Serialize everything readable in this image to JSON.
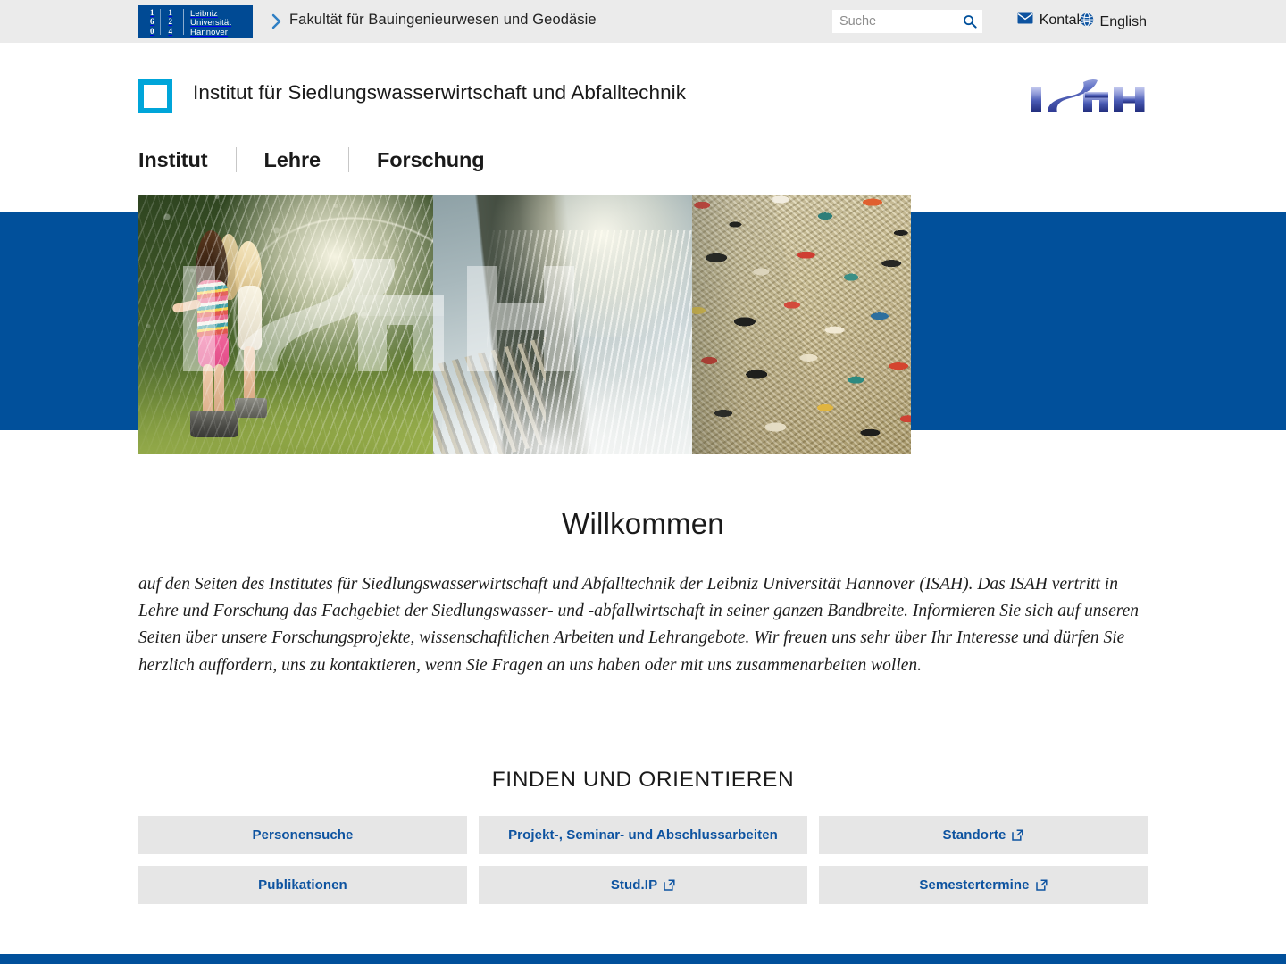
{
  "topbar": {
    "university_logo": {
      "grid_chars": [
        "1",
        "1",
        "6",
        "2",
        "0",
        "4"
      ],
      "lines": [
        "Leibniz",
        "Universität",
        "Hannover"
      ]
    },
    "faculty_chevron_icon": "chevron-right-icon",
    "faculty_title": "Fakultät für Bauingenieurwesen und Geodäsie",
    "search": {
      "placeholder": "Suche",
      "value": "",
      "icon": "search-icon"
    },
    "contact": {
      "label": "Kontakt",
      "icon": "envelope-icon"
    },
    "language": {
      "label": "English",
      "icon": "globe-icon"
    }
  },
  "institute_header": {
    "square_icon": "square-outline-icon",
    "title": "Institut für Siedlungswasserwirtschaft und Abfalltechnik",
    "logo_text": "ISAH",
    "logo_name": "isah-logo"
  },
  "mainnav": {
    "items": [
      {
        "label": "Institut"
      },
      {
        "label": "Lehre"
      },
      {
        "label": "Forschung"
      }
    ]
  },
  "hero": {
    "watermark_text": "ISAH",
    "panes": [
      {
        "name": "children-sprinkler-photo"
      },
      {
        "name": "water-weir-channel-photo"
      },
      {
        "name": "shredded-waste-photo"
      }
    ],
    "band_color": "#01509b"
  },
  "welcome": {
    "title": "Willkommen",
    "body": "auf den Seiten des Institutes für Siedlungswasserwirtschaft und Abfalltechnik der Leibniz Universität Hannover (ISAH). Das ISAH vertritt in Lehre und Forschung das Fachgebiet der Siedlungswasser- und -abfallwirtschaft in seiner ganzen Bandbreite. Informieren Sie sich auf unseren Seiten über unsere Forschungsprojekte, wissenschaftlichen Arbeiten und Lehrangebote. Wir freuen uns sehr über Ihr Interesse und dürfen Sie herzlich auffordern, uns zu kontaktieren, wenn Sie Fragen an uns haben oder mit uns zusammenarbeiten wollen."
  },
  "finder": {
    "heading": "FINDEN UND ORIENTIEREN",
    "tiles": [
      {
        "label": "Personensuche",
        "external": false
      },
      {
        "label": "Projekt-, Seminar- und Abschlussarbeiten",
        "external": false
      },
      {
        "label": "Standorte",
        "external": true
      },
      {
        "label": "Publikationen",
        "external": false
      },
      {
        "label": "Stud.IP",
        "external": true
      },
      {
        "label": "Semestertermine",
        "external": true
      }
    ]
  },
  "colors": {
    "brand_blue": "#01509b",
    "leibniz_blue": "#004a94",
    "accent_cyan": "#00a5d9",
    "link_blue": "#0d53a0",
    "topbar_bg": "#ebebeb",
    "tile_bg": "#e6e6e6"
  }
}
